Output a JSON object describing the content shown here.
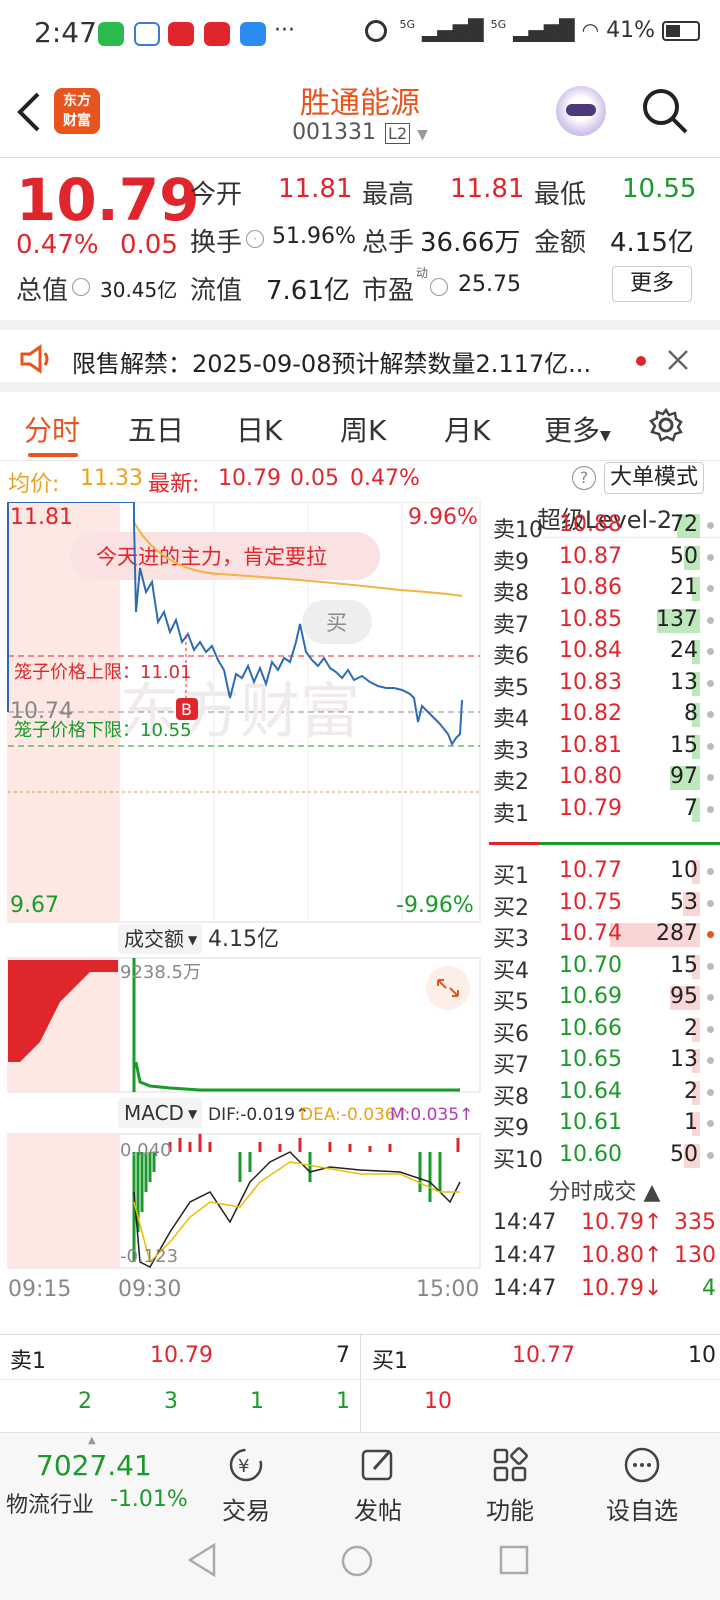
{
  "status": {
    "time": "2:47",
    "dots": "···",
    "signal1": "5G",
    "signal2": "5G",
    "battery": "41%"
  },
  "header": {
    "logo_line1": "东方",
    "logo_line2": "财富",
    "stock_name": "胜通能源",
    "stock_code": "001331",
    "level_badge": "L2"
  },
  "quote": {
    "price": "10.79",
    "change_pct": "0.47%",
    "change_abs": "0.05",
    "open_label": "今开",
    "open": "11.81",
    "high_label": "最高",
    "high": "11.81",
    "low_label": "最低",
    "low": "10.55",
    "turnover_label": "换手",
    "turnover": "51.96%",
    "volume_label": "总手",
    "volume": "36.66万",
    "amount_label": "金额",
    "amount": "4.15亿",
    "mktcap_label": "总值",
    "mktcap": "30.45亿",
    "float_label": "流值",
    "float_cap": "7.61亿",
    "pe_label": "市盈",
    "pe_sup": "动",
    "pe": "25.75",
    "more": "更多"
  },
  "notice": {
    "text": "限售解禁：2025-09-08预计解禁数量2.117亿..."
  },
  "tabs": [
    {
      "label": "分时"
    },
    {
      "label": "五日"
    },
    {
      "label": "日K"
    },
    {
      "label": "周K"
    },
    {
      "label": "月K"
    },
    {
      "label": "更多"
    }
  ],
  "infobar": {
    "avg_label": "均价:",
    "avg": "11.33",
    "latest_label": "最新:",
    "latest": "10.79",
    "chg": "0.05",
    "pct": "0.47%",
    "big_order": "大单模式"
  },
  "chart": {
    "top_price": "11.81",
    "top_pct": "9.96%",
    "bottom_price": "9.67",
    "bottom_pct": "-9.96%",
    "mid_price": "10.74",
    "upper_limit": "笼子价格上限：11.01",
    "lower_limit": "笼子价格下限：10.55",
    "ad_banner": "今天进的主力，肯定要拉",
    "buy_badge": "买",
    "b_marker": "B",
    "volume_label": "成交额",
    "volume_total": "4.15亿",
    "volume_max": "9238.5万",
    "macd_label": "MACD",
    "dif": "DIF:-0.019↑",
    "dea": "DEA:-0.036↑",
    "m": "M:0.035↑",
    "macd_top": "0.040",
    "macd_bottom": "-0.123",
    "t_start": "09:15",
    "t_open": "09:30",
    "t_end": "15:00"
  },
  "orderbook": {
    "title": "超级Level-2",
    "asks": [
      {
        "label": "卖10",
        "price": "10.88",
        "vol": "72"
      },
      {
        "label": "卖9",
        "price": "10.87",
        "vol": "50"
      },
      {
        "label": "卖8",
        "price": "10.86",
        "vol": "21"
      },
      {
        "label": "卖7",
        "price": "10.85",
        "vol": "137"
      },
      {
        "label": "卖6",
        "price": "10.84",
        "vol": "24"
      },
      {
        "label": "卖5",
        "price": "10.83",
        "vol": "13"
      },
      {
        "label": "卖4",
        "price": "10.82",
        "vol": "8"
      },
      {
        "label": "卖3",
        "price": "10.81",
        "vol": "15"
      },
      {
        "label": "卖2",
        "price": "10.80",
        "vol": "97"
      },
      {
        "label": "卖1",
        "price": "10.79",
        "vol": "7"
      }
    ],
    "bids": [
      {
        "label": "买1",
        "price": "10.77",
        "vol": "10"
      },
      {
        "label": "买2",
        "price": "10.75",
        "vol": "53"
      },
      {
        "label": "买3",
        "price": "10.74",
        "vol": "287"
      },
      {
        "label": "买4",
        "price": "10.70",
        "vol": "15"
      },
      {
        "label": "买5",
        "price": "10.69",
        "vol": "95"
      },
      {
        "label": "买6",
        "price": "10.66",
        "vol": "2"
      },
      {
        "label": "买7",
        "price": "10.65",
        "vol": "13"
      },
      {
        "label": "买8",
        "price": "10.64",
        "vol": "2"
      },
      {
        "label": "买9",
        "price": "10.61",
        "vol": "1"
      },
      {
        "label": "买10",
        "price": "10.60",
        "vol": "50"
      }
    ],
    "ticks_title": "分时成交",
    "ticks": [
      {
        "time": "14:47",
        "price": "10.79↑",
        "vol": "335"
      },
      {
        "time": "14:47",
        "price": "10.80↑",
        "vol": "130"
      },
      {
        "time": "14:47",
        "price": "10.79↓",
        "vol": "4"
      }
    ]
  },
  "tradebar": {
    "sell_label": "卖1",
    "sell_price": "10.79",
    "sell_vol": "7",
    "buy_label": "买1",
    "buy_price": "10.77",
    "buy_vol": "10",
    "queue_sell": [
      "2",
      "3",
      "1",
      "1"
    ],
    "queue_buy": [
      "10"
    ]
  },
  "bottomnav": {
    "index_value": "7027.41",
    "index_name": "物流行业",
    "index_pct": "-1.01%",
    "trade": "交易",
    "post": "发帖",
    "function": "功能",
    "watch": "设自选"
  },
  "colors": {
    "up": "#e0262d",
    "down": "#1a9a2a",
    "accent": "#e8541e",
    "price_line": "#2d6cb5",
    "avg_line": "#f0b440"
  }
}
